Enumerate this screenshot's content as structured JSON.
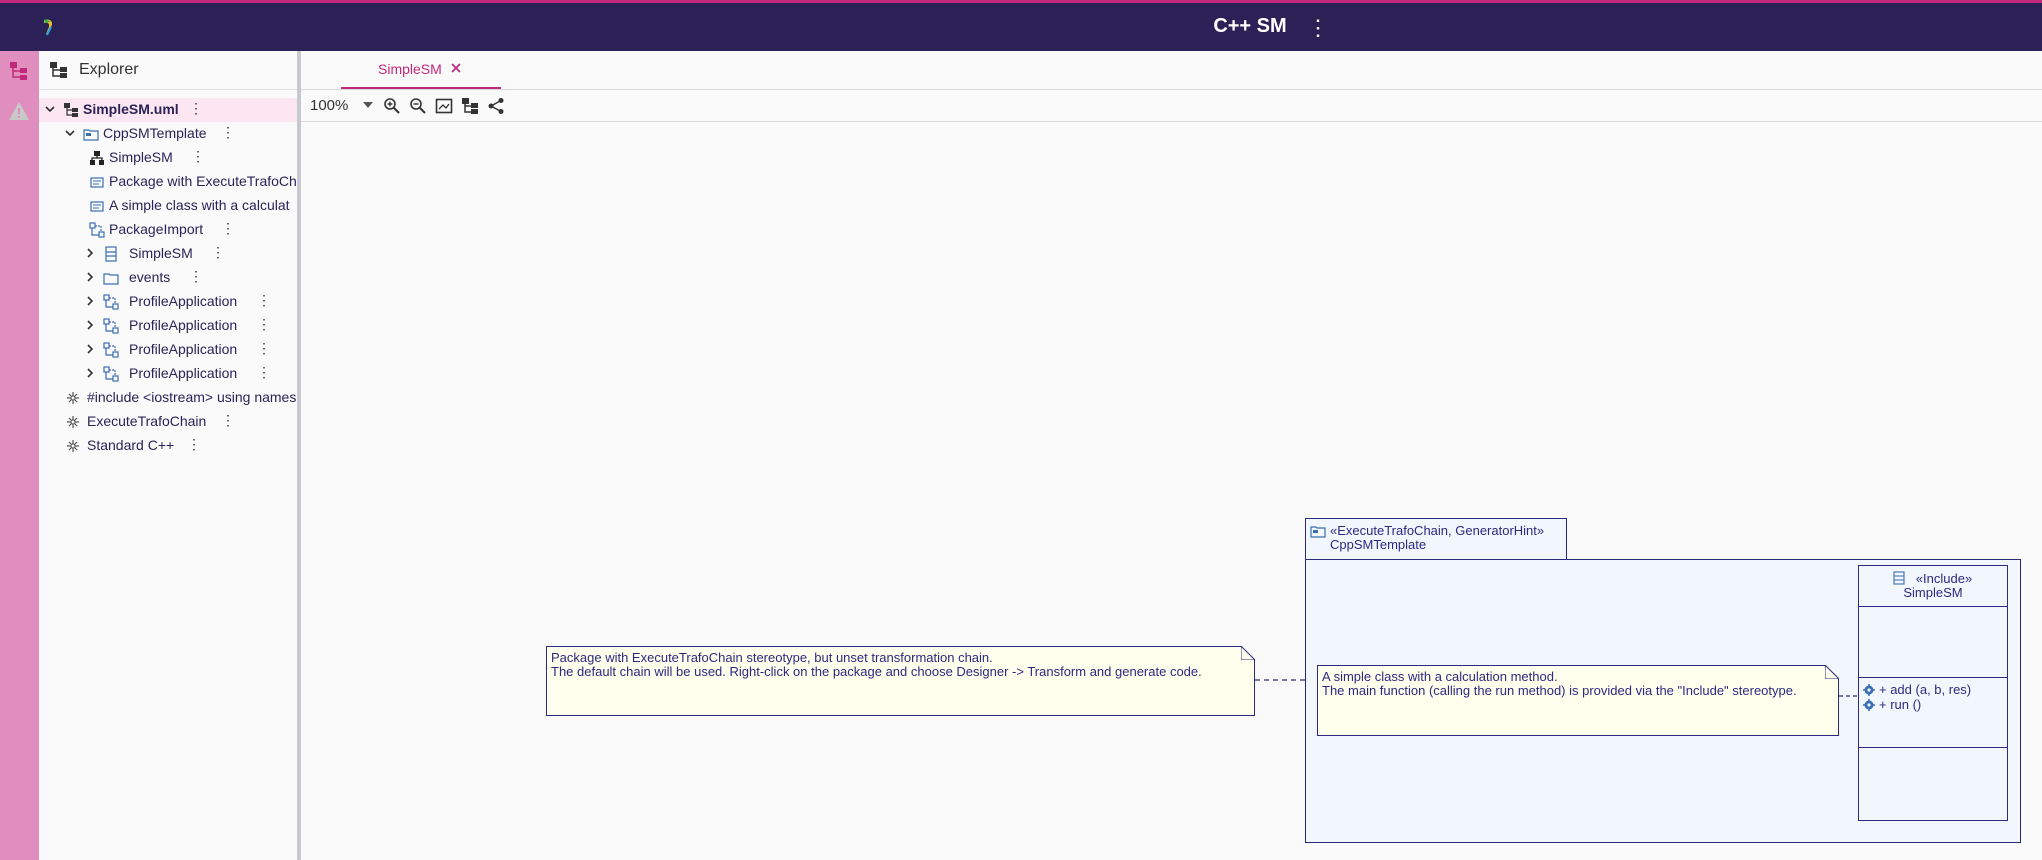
{
  "header": {
    "title": "C++ SM",
    "menu_icon": "more-vert-icon",
    "logo_icon": "app-logo-icon"
  },
  "activity_bar": {
    "items": [
      {
        "icon": "explorer-tree-icon"
      },
      {
        "icon": "warning-icon"
      }
    ]
  },
  "sidebar": {
    "title": "Explorer",
    "tree": [
      {
        "label": "SimpleSM.uml",
        "icon": "model-icon",
        "selected": true
      },
      {
        "label": "CppSMTemplate",
        "icon": "package-icon"
      },
      {
        "label": "SimpleSM",
        "icon": "statemachine-icon"
      },
      {
        "label": "Package with ExecuteTrafoCh",
        "icon": "comment-icon"
      },
      {
        "label": "A simple class with a calculat",
        "icon": "comment-icon"
      },
      {
        "label": "PackageImport",
        "icon": "package-import-icon"
      },
      {
        "label": "SimpleSM",
        "icon": "class-icon"
      },
      {
        "label": "events",
        "icon": "folder-icon"
      },
      {
        "label": "ProfileApplication",
        "icon": "profile-application-icon"
      },
      {
        "label": "ProfileApplication",
        "icon": "profile-application-icon"
      },
      {
        "label": "ProfileApplication",
        "icon": "profile-application-icon"
      },
      {
        "label": "ProfileApplication",
        "icon": "profile-application-icon"
      },
      {
        "label": "#include <iostream> using names",
        "icon": "stereotype-application-icon"
      },
      {
        "label": "ExecuteTrafoChain",
        "icon": "stereotype-application-icon"
      },
      {
        "label": "Standard C++",
        "icon": "stereotype-application-icon"
      }
    ]
  },
  "editor": {
    "tab_label": "SimpleSM",
    "zoom": "100%"
  },
  "diagram": {
    "note1": {
      "line1": "Package with ExecuteTrafoChain stereotype, but unset transformation chain.",
      "line2": "The default chain will be used. Right-click on the package and choose Designer -> Transform and generate code."
    },
    "package": {
      "stereotype": "«ExecuteTrafoChain, GeneratorHint»",
      "name": "CppSMTemplate"
    },
    "note2": {
      "line1": "A simple class with a calculation method.",
      "line2": "The main function (calling the run method) is provided via the \"Include\" stereotype."
    },
    "class": {
      "stereotype": "«Include»",
      "name": "SimpleSM",
      "operations": [
        "+ add (a, b, res)",
        "+ run ()"
      ]
    }
  },
  "colors": {
    "header_bg": "#2c2157",
    "accent": "#c2287a",
    "activity_bar": "#e08ebd",
    "diagram_stroke": "#2c2980",
    "note_fill": "#ffffee",
    "package_fill": "#f1f7fd"
  }
}
